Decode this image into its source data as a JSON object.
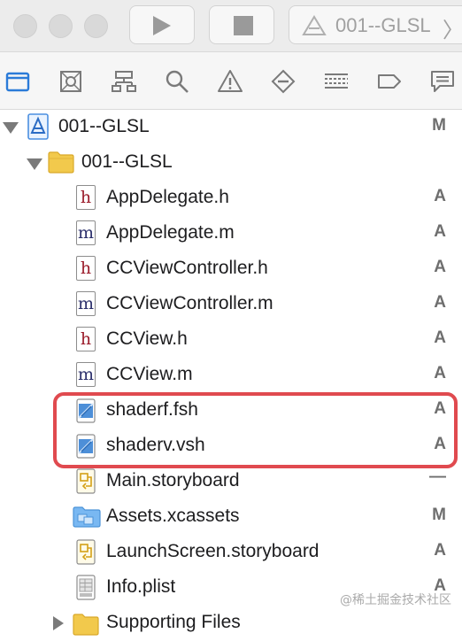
{
  "toolbar": {
    "scheme_label": "001--GLSL"
  },
  "navigator_tabs": [
    {
      "name": "project-navigator",
      "icon": "folder-icon"
    },
    {
      "name": "source-control-navigator",
      "icon": "source-control-icon"
    },
    {
      "name": "symbol-navigator",
      "icon": "hierarchy-icon"
    },
    {
      "name": "find-navigator",
      "icon": "search-icon"
    },
    {
      "name": "issue-navigator",
      "icon": "warning-icon"
    },
    {
      "name": "test-navigator",
      "icon": "diamond-icon"
    },
    {
      "name": "debug-navigator",
      "icon": "list-icon"
    },
    {
      "name": "breakpoint-navigator",
      "icon": "breakpoint-icon"
    },
    {
      "name": "report-navigator",
      "icon": "speech-bubble-icon"
    }
  ],
  "tree": {
    "project": {
      "label": "001--GLSL",
      "status": "M"
    },
    "group": {
      "label": "001--GLSL"
    },
    "files": [
      {
        "label": "AppDelegate.h",
        "status": "A",
        "icon": "header-file-icon"
      },
      {
        "label": "AppDelegate.m",
        "status": "A",
        "icon": "objc-file-icon"
      },
      {
        "label": "CCViewController.h",
        "status": "A",
        "icon": "header-file-icon"
      },
      {
        "label": "CCViewController.m",
        "status": "A",
        "icon": "objc-file-icon"
      },
      {
        "label": "CCView.h",
        "status": "A",
        "icon": "header-file-icon"
      },
      {
        "label": "CCView.m",
        "status": "A",
        "icon": "objc-file-icon"
      },
      {
        "label": "shaderf.fsh",
        "status": "A",
        "icon": "shader-file-icon"
      },
      {
        "label": "shaderv.vsh",
        "status": "A",
        "icon": "shader-file-icon"
      },
      {
        "label": "Main.storyboard",
        "status": "—",
        "icon": "storyboard-icon"
      },
      {
        "label": "Assets.xcassets",
        "status": "M",
        "icon": "assets-folder-icon"
      },
      {
        "label": "LaunchScreen.storyboard",
        "status": "A",
        "icon": "storyboard-icon"
      },
      {
        "label": "Info.plist",
        "status": "A",
        "icon": "plist-icon"
      }
    ],
    "supporting": {
      "label": "Supporting Files"
    }
  },
  "watermark": "@稀土掘金技术社区",
  "colors": {
    "highlight": "#e04a4f",
    "selected_tab": "#2b7bd8",
    "folder": "#f2c94c"
  }
}
